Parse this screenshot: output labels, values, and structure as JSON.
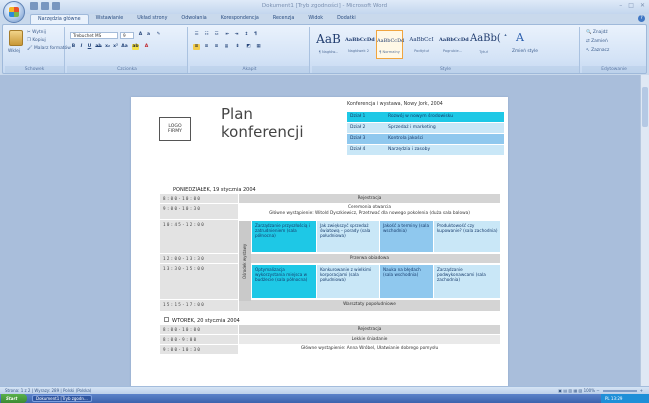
{
  "window": {
    "title": "Dokument1 [Tryb zgodności] - Microsoft Word",
    "controls": [
      "–",
      "□",
      "✕"
    ]
  },
  "ribbon": {
    "tabs": [
      "Narzędzia główne",
      "Wstawianie",
      "Układ strony",
      "Odwołania",
      "Korespondencja",
      "Recenzja",
      "Widok",
      "Dodatki"
    ],
    "clipboard": {
      "paste": "Wklej",
      "cut": "Wytnij",
      "copy": "Kopiuj",
      "painter": "Malarz formatów",
      "label": "Schowek"
    },
    "font": {
      "name": "Trebuchet MS",
      "size": "9",
      "label": "Czcionka"
    },
    "paragraph": {
      "label": "Akapit"
    },
    "styles": {
      "label": "Style",
      "items": [
        {
          "sample": "AaB",
          "name": "¶ Nagłów..."
        },
        {
          "sample": "AaBbCcDd",
          "name": "Nagłówek 2"
        },
        {
          "sample": "AaBbCcDd",
          "name": "¶ Normalny"
        },
        {
          "sample": "AaBbCcI",
          "name": "Podtytuł"
        },
        {
          "sample": "AaBbCcDd",
          "name": "Pogrubie..."
        },
        {
          "sample": "AaBb(",
          "name": "Tytuł"
        }
      ],
      "change": "Zmień style"
    },
    "editing": {
      "label": "Edytowanie",
      "find": "Znajdź",
      "replace": "Zamień",
      "select": "Zaznacz"
    }
  },
  "document": {
    "logo": "LOGO\nFIRMY",
    "title": "Plan\nkonferencji",
    "event": "Konferencja i wystawa, Nowy Jork, 2004",
    "departments": [
      {
        "code": "Dział 1",
        "name": "Rozwój w nowym środowisku",
        "color": "#1ec8e6"
      },
      {
        "code": "Dział 2",
        "name": "Sprzedaż i marketing",
        "color": "#c9e7f7"
      },
      {
        "code": "Dział 3",
        "name": "Kontrola jakości",
        "color": "#8fc8ee"
      },
      {
        "code": "Dział 4",
        "name": "Narzędzia i zasoby",
        "color": "#c9e7f7"
      }
    ],
    "day1": {
      "heading": "PONIEDZIAŁEK, 19 stycznia 2004",
      "track": "Ośrodek wystawy",
      "rows": [
        {
          "time": "8:00-10:00",
          "text": "Rejestracja"
        },
        {
          "time": "9:00-10:30",
          "text": "Ceremonia otwarcia\nGłówne wystąpienie: Witold Dyszkiewicz, Przetrwać dla nowego pokolenia (duża sala balowa)"
        },
        {
          "time": "10:45-12:00",
          "sessions": [
            "Zarządzanie przyszłością i zatrudnieniem (sala północna)",
            "Jak zwiększyć sprzedaż światową – porady (sala południowa)",
            "Jakość a terminy (sala wschodnia)",
            "Produktowość czy kupowanie? (sala zachodnia)"
          ]
        },
        {
          "time": "12:00-13:30",
          "text": "Przerwa obiadowa"
        },
        {
          "time": "13:30-15:00",
          "sessions": [
            "Optymalizacja wykorzystania miejsca w budżecie (sala północna)",
            "Konkurowanie z wielkimi korporacjami (sala południowa)",
            "Nauka na błędach (sala wschodnia)",
            "Zarządzanie podwykonawcami (sala zachodnia)"
          ]
        },
        {
          "time": "15:15-17:00",
          "text": "Warsztaty popołudniowe"
        }
      ]
    },
    "day2": {
      "heading": "WTOREK, 20 stycznia 2004",
      "rows": [
        {
          "time": "8:00-10:00",
          "text": "Rejestracja"
        },
        {
          "time": "8:00-9:00",
          "text": "Lekkie śniadanie"
        },
        {
          "time": "9:00-10:30",
          "text": "Główne wystąpienie: Anna Wróbel, Ułatwianie dobrego pomysłu"
        }
      ]
    },
    "session_colors": [
      "#1ec8e6",
      "#c9e7f7",
      "#8fc8ee",
      "#c9e7f7"
    ]
  },
  "statusbar": {
    "page": "Strona: 1 z 2",
    "words": "Wyrazy: 289",
    "language": "Polski (Polska)",
    "zoom": "100%"
  },
  "taskbar": {
    "start": "Start",
    "task": "Dokument1 [Tryb zgodn...",
    "tray": "PL 13:29"
  }
}
